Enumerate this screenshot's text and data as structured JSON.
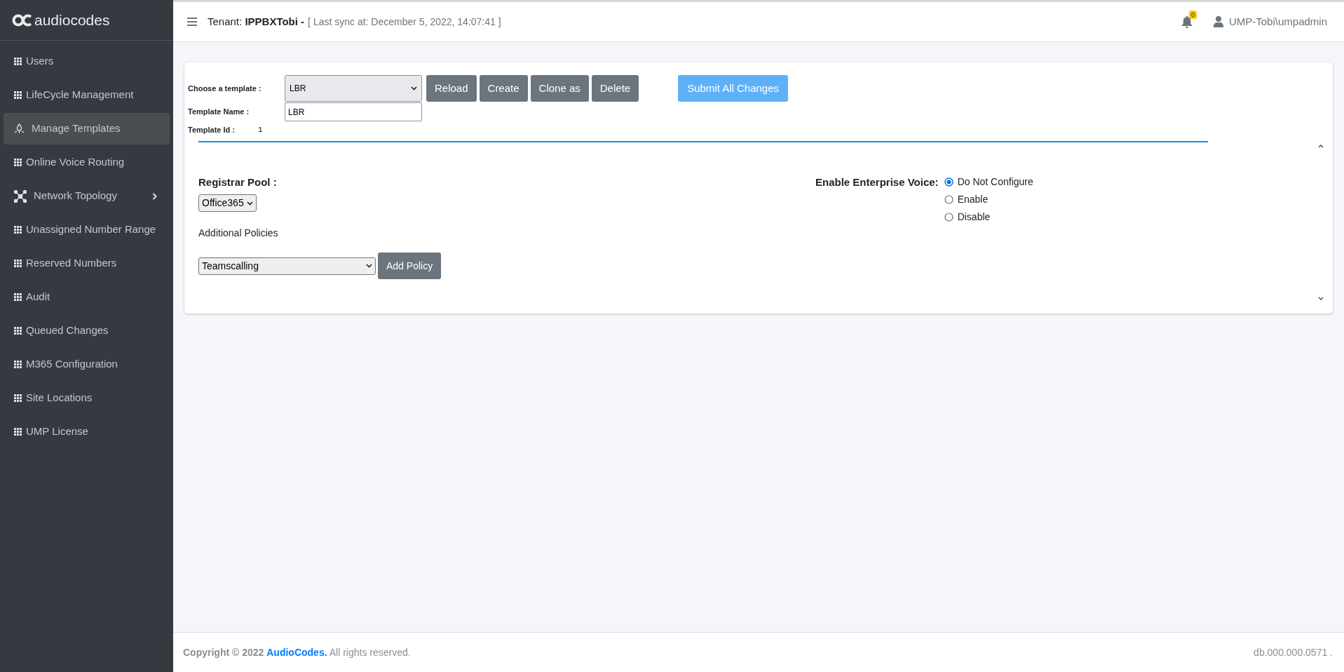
{
  "sidebar": {
    "logo_text": "audiocodes",
    "items": [
      {
        "label": "Users",
        "kind": "grid",
        "selected": false,
        "has_submenu": false
      },
      {
        "label": "LifeCycle Management",
        "kind": "grid",
        "selected": false,
        "has_submenu": false
      },
      {
        "label": "Manage Templates",
        "kind": "templates",
        "selected": true,
        "has_submenu": false
      },
      {
        "label": "Online Voice Routing",
        "kind": "grid",
        "selected": false,
        "has_submenu": false
      },
      {
        "label": "Network Topology",
        "kind": "network",
        "selected": false,
        "has_submenu": true
      },
      {
        "label": "Unassigned Number Range",
        "kind": "grid",
        "selected": false,
        "has_submenu": false
      },
      {
        "label": "Reserved Numbers",
        "kind": "grid",
        "selected": false,
        "has_submenu": false
      },
      {
        "label": "Audit",
        "kind": "grid",
        "selected": false,
        "has_submenu": false
      },
      {
        "label": "Queued Changes",
        "kind": "grid",
        "selected": false,
        "has_submenu": false
      },
      {
        "label": "M365 Configuration",
        "kind": "grid",
        "selected": false,
        "has_submenu": false
      },
      {
        "label": "Site Locations",
        "kind": "grid",
        "selected": false,
        "has_submenu": false
      },
      {
        "label": "UMP License",
        "kind": "grid",
        "selected": false,
        "has_submenu": false
      }
    ]
  },
  "header": {
    "tenant": "Tenant: **IPPBXTobi -**",
    "sync": "[ Last sync at: December 5, 2022, 14:07:41 ]",
    "notification_count": "0",
    "user": "UMP-Tobi\\umpadmin"
  },
  "template": {
    "choose_label": "Choose a template :",
    "selected_template": "LBR",
    "name_label": "Template Name :",
    "name_value": "LBR",
    "id_label": "Template Id :",
    "id_value": "1",
    "buttons": [
      "Reload",
      "Create",
      "Clone as",
      "Delete"
    ],
    "submit_button": "Submit All Changes"
  },
  "settings": {
    "registrar_label": "Registrar Pool :",
    "registrar_value": "Office365",
    "policies_label": "Additional Policies",
    "policy_value": "Teamscalling",
    "add_policy_button": "Add Policy",
    "voice_label": "Enable Enterprise Voice:",
    "voice_options": [
      {
        "label": "Do Not Configure",
        "selected": true
      },
      {
        "label": "Enable",
        "selected": false
      },
      {
        "label": "Disable",
        "selected": false
      }
    ]
  },
  "footer": {
    "copyright": "Copyright © 2022",
    "link": "AudioCodes.",
    "rights": "All rights reserved.",
    "version": "db.000.000.0571 ."
  }
}
